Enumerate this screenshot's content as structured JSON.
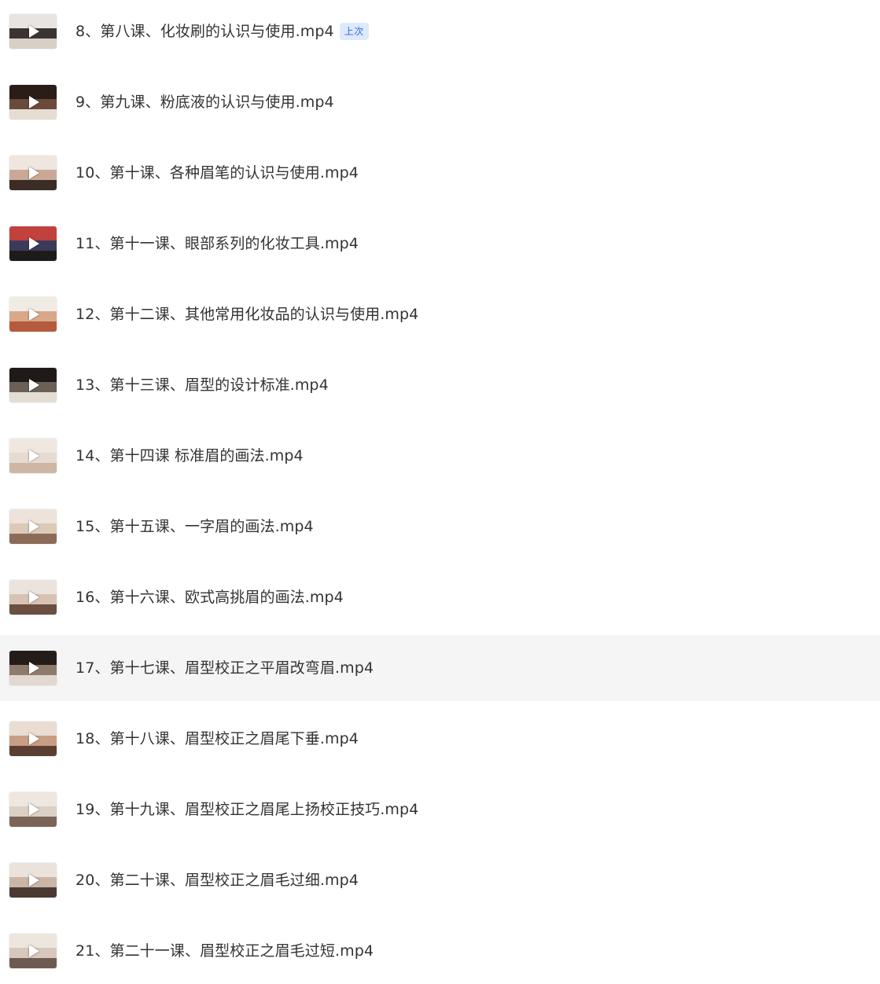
{
  "file_list": {
    "items": [
      {
        "name": "8、第八课、化妆刷的认识与使用.mp4",
        "badge": "上次",
        "thumb_colors": [
          "#e9e4df",
          "#3a3433",
          "#d9cfc6"
        ],
        "hovered": false
      },
      {
        "name": "9、第九课、粉底液的认识与使用.mp4",
        "badge": "",
        "thumb_colors": [
          "#2a1d18",
          "#6b4a3a",
          "#e6dcd2"
        ],
        "hovered": false
      },
      {
        "name": "10、第十课、各种眉笔的认识与使用.mp4",
        "badge": "",
        "thumb_colors": [
          "#efe6df",
          "#c9a996",
          "#3b2c26"
        ],
        "hovered": false
      },
      {
        "name": "11、第十一课、眼部系列的化妆工具.mp4",
        "badge": "",
        "thumb_colors": [
          "#c2413d",
          "#3b3a5a",
          "#1e1b1b"
        ],
        "hovered": false
      },
      {
        "name": "12、第十二课、其他常用化妆品的认识与使用.mp4",
        "badge": "",
        "thumb_colors": [
          "#f1ebe6",
          "#d9a88a",
          "#b65a3e"
        ],
        "hovered": false
      },
      {
        "name": "13、第十三课、眉型的设计标准.mp4",
        "badge": "",
        "thumb_colors": [
          "#1f1a17",
          "#6c5f55",
          "#e4ddd4"
        ],
        "hovered": false
      },
      {
        "name": "14、第十四课 标准眉的画法.mp4",
        "badge": "",
        "thumb_colors": [
          "#efe8e1",
          "#e6dbd0",
          "#cdb6a4"
        ],
        "hovered": false
      },
      {
        "name": "15、第十五课、一字眉的画法.mp4",
        "badge": "",
        "thumb_colors": [
          "#ede3da",
          "#dccab9",
          "#8c6c58"
        ],
        "hovered": false
      },
      {
        "name": "16、第十六课、欧式高挑眉的画法.mp4",
        "badge": "",
        "thumb_colors": [
          "#ece4dc",
          "#d7c3b3",
          "#6b4f41"
        ],
        "hovered": false
      },
      {
        "name": "17、第十七课、眉型校正之平眉改弯眉.mp4",
        "badge": "",
        "thumb_colors": [
          "#241c19",
          "#8f7b6c",
          "#e1d8cf"
        ],
        "hovered": true
      },
      {
        "name": "18、第十八课、眉型校正之眉尾下垂.mp4",
        "badge": "",
        "thumb_colors": [
          "#e9ddd2",
          "#c79e84",
          "#5a3e31"
        ],
        "hovered": false
      },
      {
        "name": "19、第十九课、眉型校正之眉尾上扬校正技巧.mp4",
        "badge": "",
        "thumb_colors": [
          "#eee7e0",
          "#dcd0c5",
          "#7a6458"
        ],
        "hovered": false
      },
      {
        "name": "20、第二十课、眉型校正之眉毛过细.mp4",
        "badge": "",
        "thumb_colors": [
          "#ebe3db",
          "#c9b6a6",
          "#4a3a33"
        ],
        "hovered": false
      },
      {
        "name": "21、第二十一课、眉型校正之眉毛过短.mp4",
        "badge": "",
        "thumb_colors": [
          "#ede6df",
          "#d6c8bb",
          "#6d5a50"
        ],
        "hovered": false
      }
    ]
  }
}
